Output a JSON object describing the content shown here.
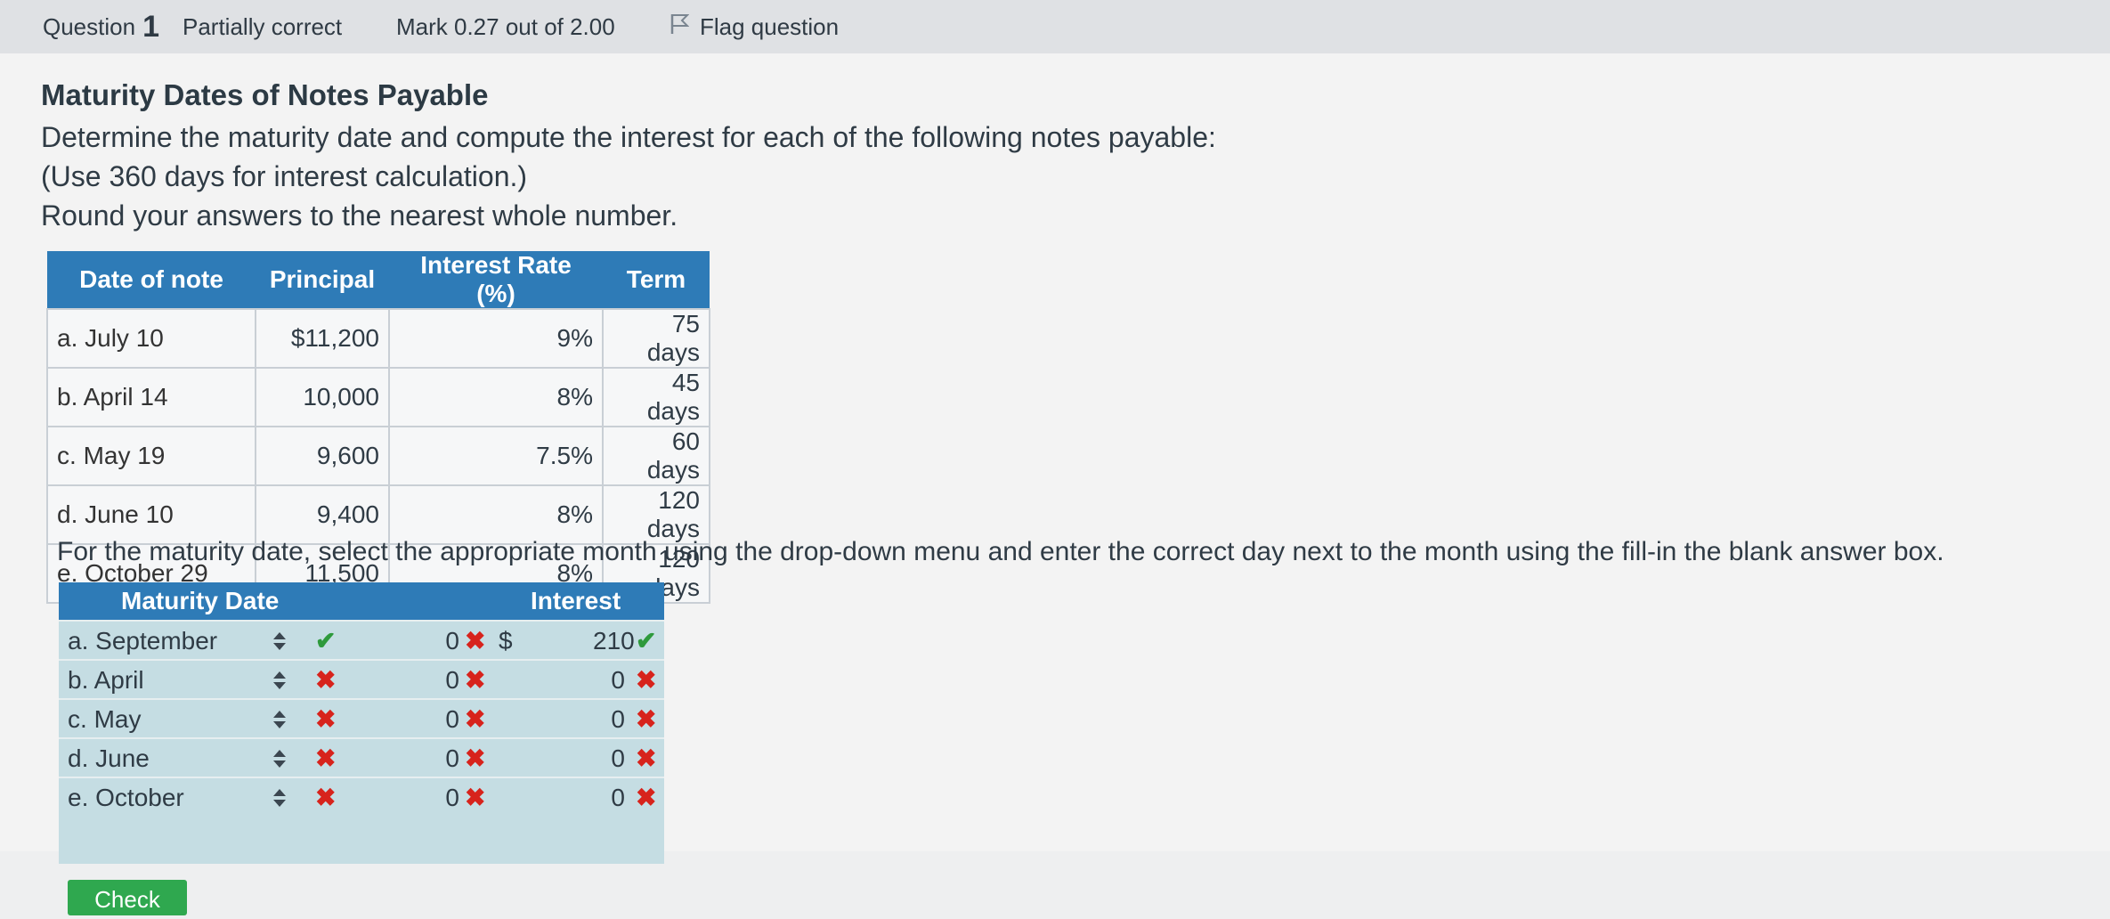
{
  "question_bar": {
    "question_label": "Question",
    "question_number": "1",
    "status": "Partially correct",
    "mark": "Mark 0.27 out of 2.00",
    "flag_label": "Flag question"
  },
  "problem": {
    "title": "Maturity Dates of Notes Payable",
    "line1": "Determine the maturity date and compute the interest for each of the following notes payable:",
    "line2": "(Use 360 days for interest calculation.)",
    "line3": "Round your answers to the nearest whole number."
  },
  "notes_table": {
    "headers": [
      "Date of note",
      "Principal",
      "Interest Rate (%)",
      "Term"
    ],
    "rows": [
      {
        "label": "a.",
        "date": "July 10",
        "principal": "$11,200",
        "rate": "9%",
        "term": "75 days"
      },
      {
        "label": "b.",
        "date": "April 14",
        "principal": "10,000",
        "rate": "8%",
        "term": "45 days"
      },
      {
        "label": "c.",
        "date": "May 19",
        "principal": "9,600",
        "rate": "7.5%",
        "term": "60 days"
      },
      {
        "label": "d.",
        "date": "June 10",
        "principal": "9,400",
        "rate": "8%",
        "term": "120 days"
      },
      {
        "label": "e.",
        "date": "October 29",
        "principal": "11,500",
        "rate": "8%",
        "term": "120 days"
      }
    ]
  },
  "instruction": "For the maturity date, select the appropriate month using the drop-down menu and enter the correct day next to the month using the fill-in the blank answer box.",
  "answer_table": {
    "headers": {
      "maturity": "Maturity Date",
      "interest": "Interest"
    },
    "rows": [
      {
        "label": "a.",
        "month": "September",
        "month_mark": "✔",
        "day": "0",
        "day_mark": "✖",
        "currency": "$",
        "interest": "210",
        "interest_mark": "✔"
      },
      {
        "label": "b.",
        "month": "April",
        "month_mark": "✖",
        "day": "0",
        "day_mark": "✖",
        "currency": "",
        "interest": "0",
        "interest_mark": "✖"
      },
      {
        "label": "c.",
        "month": "May",
        "month_mark": "✖",
        "day": "0",
        "day_mark": "✖",
        "currency": "",
        "interest": "0",
        "interest_mark": "✖"
      },
      {
        "label": "d.",
        "month": "June",
        "month_mark": "✖",
        "day": "0",
        "day_mark": "✖",
        "currency": "",
        "interest": "0",
        "interest_mark": "✖"
      },
      {
        "label": "e.",
        "month": "October",
        "month_mark": "✖",
        "day": "0",
        "day_mark": "✖",
        "currency": "",
        "interest": "0",
        "interest_mark": "✖"
      }
    ]
  },
  "check_button": "Check",
  "colors": {
    "header_blue": "#2e7bb7",
    "correct_green": "#2e9a3c",
    "incorrect_red": "#d7231c",
    "answer_bg": "#c5dde3"
  }
}
